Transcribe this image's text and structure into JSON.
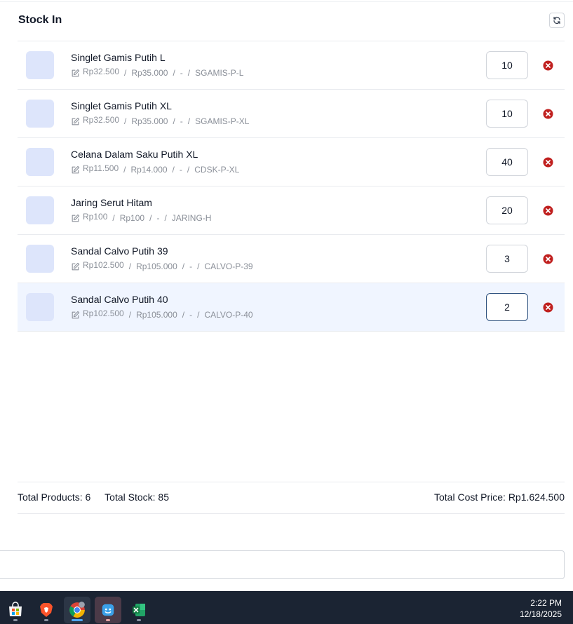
{
  "header": {
    "title": "Stock In",
    "refresh_icon": "refresh-icon"
  },
  "items": [
    {
      "name": "Singlet Gamis Putih L",
      "cost": "Rp32.500",
      "price": "Rp35.000",
      "variant": "-",
      "sku": "SGAMIS-P-L",
      "qty": "10"
    },
    {
      "name": "Singlet Gamis Putih XL",
      "cost": "Rp32.500",
      "price": "Rp35.000",
      "variant": "-",
      "sku": "SGAMIS-P-XL",
      "qty": "10"
    },
    {
      "name": "Celana Dalam Saku Putih XL",
      "cost": "Rp11.500",
      "price": "Rp14.000",
      "variant": "-",
      "sku": "CDSK-P-XL",
      "qty": "40"
    },
    {
      "name": "Jaring Serut Hitam",
      "cost": "Rp100",
      "price": "Rp100",
      "variant": "-",
      "sku": "JARING-H",
      "qty": "20"
    },
    {
      "name": "Sandal Calvo Putih 39",
      "cost": "Rp102.500",
      "price": "Rp105.000",
      "variant": "-",
      "sku": "CALVO-P-39",
      "qty": "3"
    },
    {
      "name": "Sandal Calvo Putih 40",
      "cost": "Rp102.500",
      "price": "Rp105.000",
      "variant": "-",
      "sku": "CALVO-P-40",
      "qty": "2"
    }
  ],
  "separator": "/",
  "summary": {
    "total_products": "Total Products: 6",
    "total_stock": "Total Stock: 85",
    "total_cost": "Total Cost Price: Rp1.624.500"
  },
  "taskbar": {
    "apps": [
      "store-icon",
      "brave-browser-icon",
      "chrome-icon",
      "app-icon",
      "excel-icon"
    ],
    "time": "2:22 PM",
    "date": "12/18/2025"
  },
  "colors": {
    "accent": "#2b4f7e",
    "remove": "#c0201f",
    "thumb": "#dde5fb",
    "selected_row": "#f0f5ff",
    "taskbar": "#1b2433"
  }
}
